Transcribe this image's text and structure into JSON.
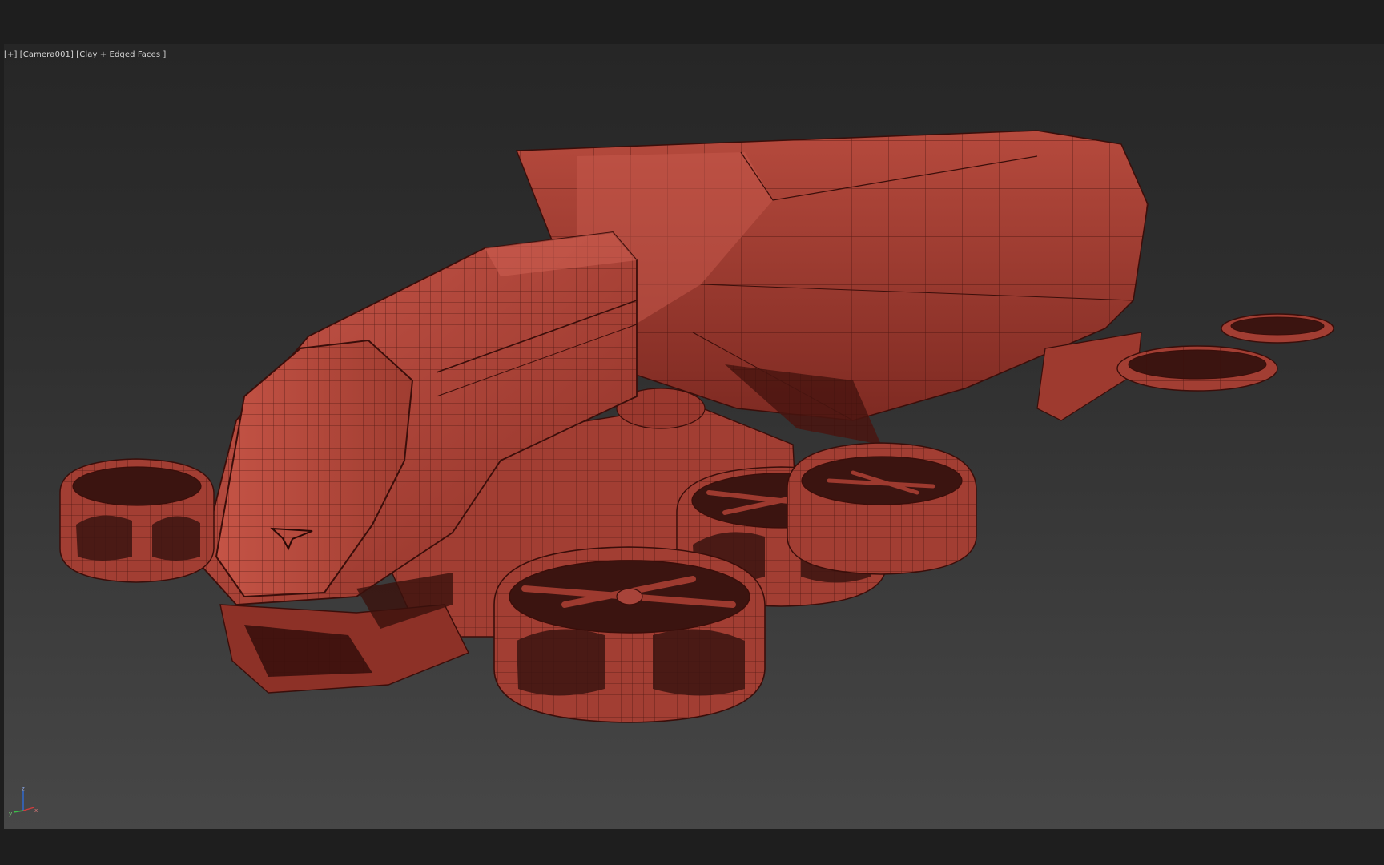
{
  "viewport": {
    "label_plus": "[+]",
    "label_camera": "[Camera001]",
    "label_shading": "[Clay + Edged Faces ]"
  },
  "colors": {
    "background": "#1e1e1e",
    "viewport_top": "#262626",
    "viewport_bottom": "#474747",
    "clay": "#b2463a",
    "clay_shadow": "#7a2a22",
    "wire": "#3a0e0a"
  },
  "axis": {
    "x": "x",
    "y": "y",
    "z": "z"
  }
}
